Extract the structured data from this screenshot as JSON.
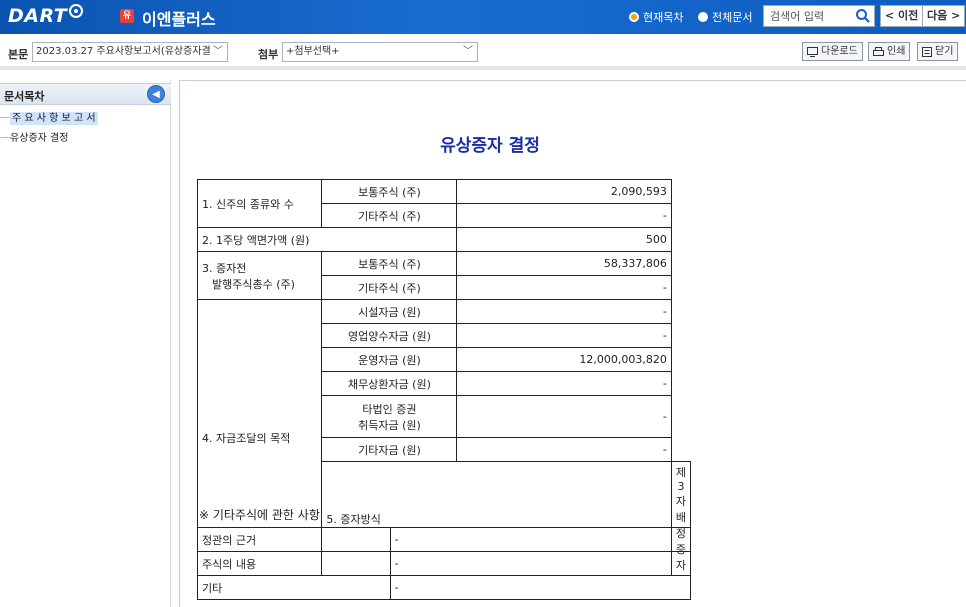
{
  "header": {
    "logo": "DART",
    "company_badge": "유",
    "company_name": "이엔플러스",
    "scope_current": "현재목차",
    "scope_all": "전체문서",
    "search_placeholder": "검색어 입력",
    "prev_label": "< 이전",
    "next_label": "다음 >"
  },
  "subbar": {
    "body_label": "본문",
    "body_select": "2023.03.27 주요사항보고서(유상증자결",
    "attach_label": "첨부",
    "attach_select": "+첨부선택+",
    "download": "다운로드",
    "print": "인쇄",
    "close": "닫기"
  },
  "sidebar": {
    "title": "문서목차",
    "items": [
      {
        "label": "주 요 사 항 보 고 서",
        "selected": true
      },
      {
        "label": "유상증자 결정",
        "selected": false
      }
    ]
  },
  "document": {
    "title": "유상증자 결정",
    "rows": {
      "r1_label": "1. 신주의 종류와 수",
      "r1a_sub": "보통주식 (주)",
      "r1a_val": "2,090,593",
      "r1b_sub": "기타주식 (주)",
      "r1b_val": "-",
      "r2_label": "2. 1주당 액면가액 (원)",
      "r2_val": "500",
      "r3_label_1": "3. 증자전",
      "r3_label_2": "발행주식총수 (주)",
      "r3a_sub": "보통주식 (주)",
      "r3a_val": "58,337,806",
      "r3b_sub": "기타주식 (주)",
      "r3b_val": "-",
      "r4_label": "4. 자금조달의 목적",
      "r4a_sub": "시설자금 (원)",
      "r4a_val": "-",
      "r4b_sub": "영업양수자금 (원)",
      "r4b_val": "-",
      "r4c_sub": "운영자금 (원)",
      "r4c_val": "12,000,003,820",
      "r4d_sub": "채무상환자금 (원)",
      "r4d_val": "-",
      "r4e_sub_1": "타법인 증권",
      "r4e_sub_2": "취득자금 (원)",
      "r4e_val": "-",
      "r4f_sub": "기타자금 (원)",
      "r4f_val": "-",
      "r5_label": "5. 증자방식",
      "r5_val": "제3자배정증자"
    },
    "note": "※ 기타주식에 관한 사항",
    "other": [
      {
        "label": "정관의 근거",
        "value": "-"
      },
      {
        "label": "주식의 내용",
        "value": "-"
      },
      {
        "label": "기타",
        "value": "-"
      }
    ]
  }
}
